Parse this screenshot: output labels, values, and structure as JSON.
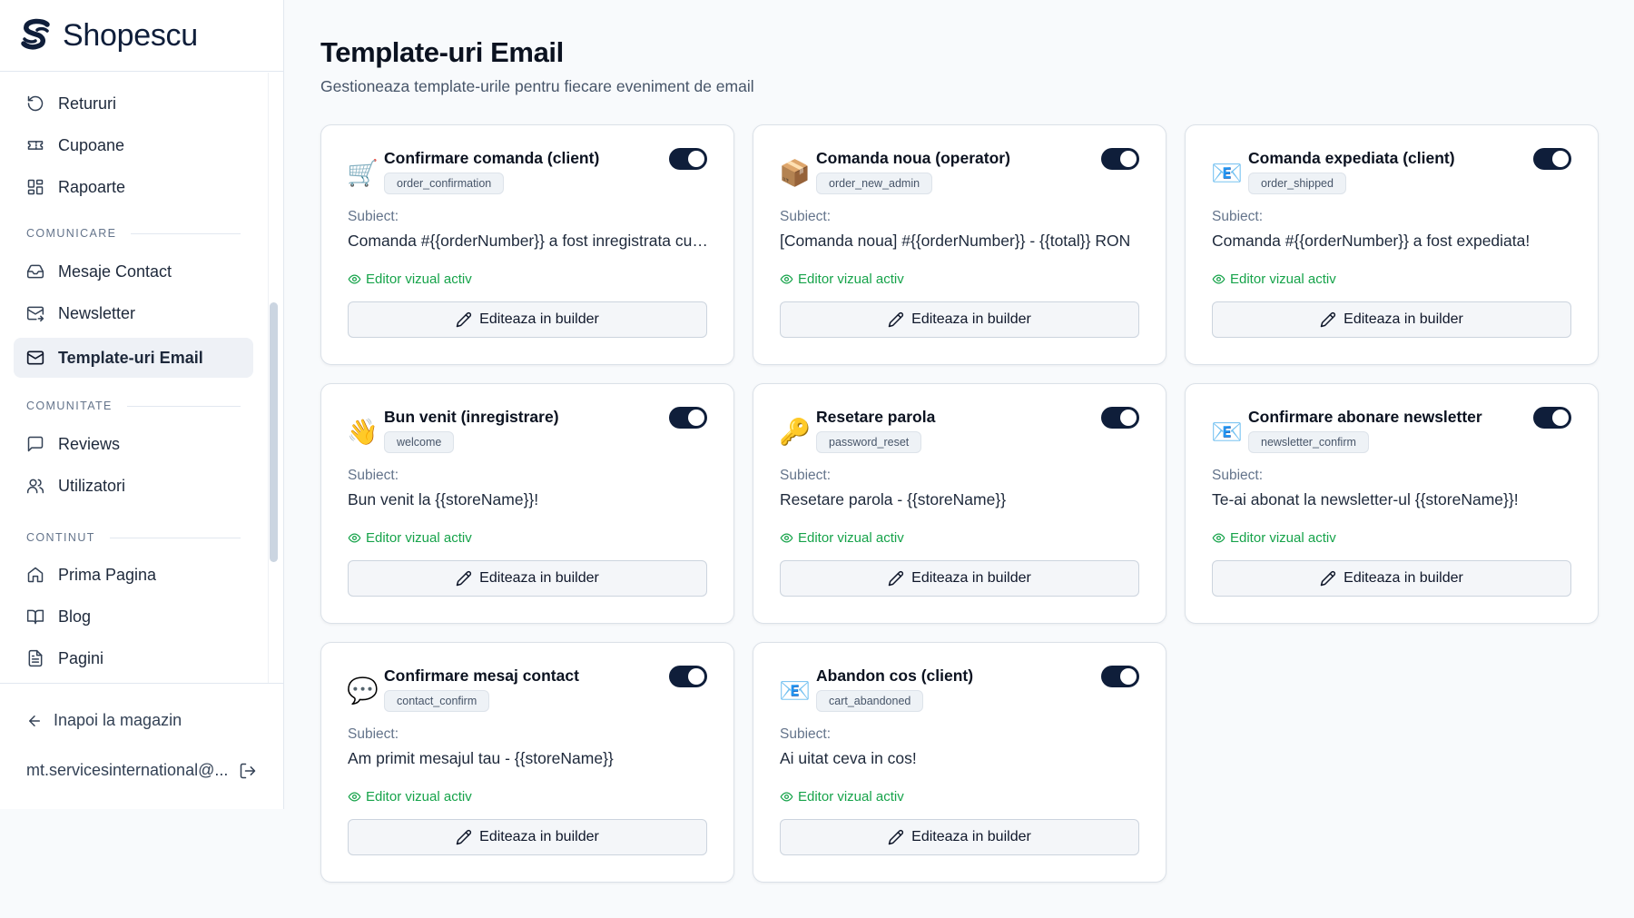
{
  "brand": {
    "name": "Shopescu"
  },
  "sidebar": {
    "items": [
      {
        "label": "Retururi",
        "icon": "rotate-ccw-icon"
      },
      {
        "label": "Cupoane",
        "icon": "ticket-icon"
      },
      {
        "label": "Rapoarte",
        "icon": "layout-grid-icon"
      },
      {
        "label": "Mesaje Contact",
        "icon": "inbox-icon"
      },
      {
        "label": "Newsletter",
        "icon": "mail-send-icon"
      },
      {
        "label": "Template-uri Email",
        "icon": "mail-icon",
        "active": true
      },
      {
        "label": "Reviews",
        "icon": "message-square-icon"
      },
      {
        "label": "Utilizatori",
        "icon": "users-icon"
      },
      {
        "label": "Prima Pagina",
        "icon": "home-icon"
      },
      {
        "label": "Blog",
        "icon": "book-open-icon"
      },
      {
        "label": "Pagini",
        "icon": "file-text-icon"
      }
    ],
    "sections": [
      "COMUNICARE",
      "COMUNITATE",
      "CONTINUT"
    ],
    "back_label": "Inapoi la magazin",
    "user_email": "mt.servicesinternational@..."
  },
  "page": {
    "title": "Template-uri Email",
    "subtitle": "Gestioneaza template-urile pentru fiecare eveniment de email"
  },
  "card_labels": {
    "subject_label": "Subiect:",
    "status": "Editor vizual activ",
    "edit_label": "Editeaza in builder"
  },
  "colors": {
    "accent": "#0f1e3a",
    "status": "#16a34a"
  },
  "cards": [
    {
      "emoji": "🛒",
      "title": "Confirmare comanda (client)",
      "key": "order_confirmation",
      "subject": "Comanda #{{orderNumber}} a fost inregistrata cu succes",
      "enabled": true
    },
    {
      "emoji": "📦",
      "title": "Comanda noua (operator)",
      "key": "order_new_admin",
      "subject": "[Comanda noua] #{{orderNumber}} - {{total}} RON",
      "enabled": true
    },
    {
      "emoji": "📧",
      "title": "Comanda expediata (client)",
      "key": "order_shipped",
      "subject": "Comanda #{{orderNumber}} a fost expediata!",
      "enabled": true
    },
    {
      "emoji": "👋",
      "title": "Bun venit (inregistrare)",
      "key": "welcome",
      "subject": "Bun venit la {{storeName}}!",
      "enabled": true
    },
    {
      "emoji": "🔑",
      "title": "Resetare parola",
      "key": "password_reset",
      "subject": "Resetare parola - {{storeName}}",
      "enabled": true
    },
    {
      "emoji": "📧",
      "title": "Confirmare abonare newsletter",
      "key": "newsletter_confirm",
      "subject": "Te-ai abonat la newsletter-ul {{storeName}}!",
      "enabled": true
    },
    {
      "emoji": "💬",
      "title": "Confirmare mesaj contact",
      "key": "contact_confirm",
      "subject": "Am primit mesajul tau - {{storeName}}",
      "enabled": true
    },
    {
      "emoji": "📧",
      "title": "Abandon cos (client)",
      "key": "cart_abandoned",
      "subject": "Ai uitat ceva in cos!",
      "enabled": true
    }
  ]
}
